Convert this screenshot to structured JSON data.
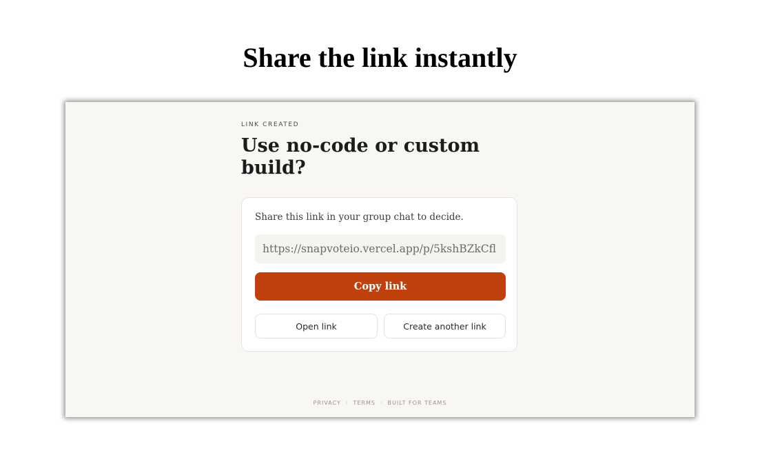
{
  "headline": "Share the link instantly",
  "app": {
    "eyebrow": "LINK CREATED",
    "title": "Use no-code or custom build?",
    "card": {
      "instruction": "Share this link in your group chat to decide.",
      "link_value": "https://snapvoteio.vercel.app/p/5kshBZkCfl",
      "copy_button": "Copy link",
      "open_button": "Open link",
      "create_another_button": "Create another link"
    },
    "footer": {
      "privacy": "PRIVACY",
      "terms": "TERMS",
      "built_for": "BUILT FOR TEAMS",
      "separator": "·"
    }
  },
  "colors": {
    "accent": "#c1410e",
    "page_background": "#f9f7f3",
    "card_background": "#ffffff"
  }
}
